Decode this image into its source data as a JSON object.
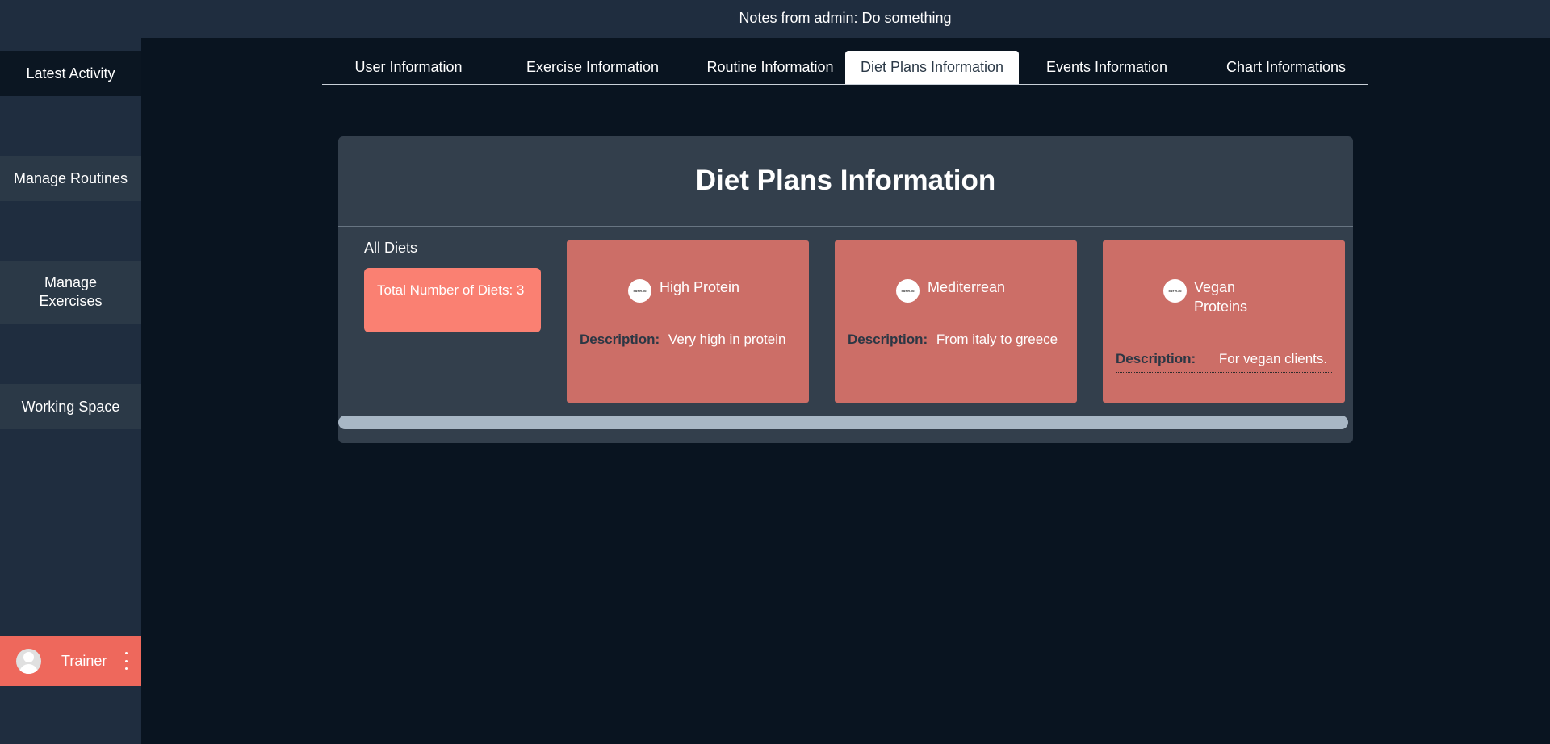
{
  "header": {
    "admin_note": "Notes from admin: Do something"
  },
  "sidebar": {
    "items": [
      {
        "label": "Latest Activity"
      },
      {
        "label": "Manage Routines"
      },
      {
        "label": "Manage\nExercises"
      },
      {
        "label": "Working Space"
      }
    ],
    "user": {
      "name": "Trainer",
      "avatar_icon": "user-avatar-icon",
      "menu_icon": "vertical-dots-icon"
    }
  },
  "tabs": [
    {
      "label": "User Information"
    },
    {
      "label": "Exercise Information"
    },
    {
      "label": "Routine Information"
    },
    {
      "label": "Diet Plans Information",
      "active": true
    },
    {
      "label": "Events Information"
    },
    {
      "label": "Chart Informations"
    }
  ],
  "panel": {
    "title": "Diet Plans Information",
    "all_diets_label": "All Diets",
    "total_label": "Total Number of Diets: 3",
    "diets": [
      {
        "logo_text": "DIET PLAN",
        "name": "High Protein",
        "description_label": "Description:",
        "description": "Very high in protein"
      },
      {
        "logo_text": "DIET PLAN",
        "name": "Mediterrean",
        "description_label": "Description:",
        "description": "From italy to greece"
      },
      {
        "logo_text": "DIET PLAN",
        "name": "Vegan\nProteins",
        "description_label": "Description:",
        "description": "For vegan clients."
      }
    ]
  },
  "colors": {
    "background": "#091420",
    "sidebar": "#1f2d3f",
    "panel": "#333f4c",
    "accent": "#ee685c",
    "card": "#cc6e67",
    "total_box": "#fa8072"
  }
}
